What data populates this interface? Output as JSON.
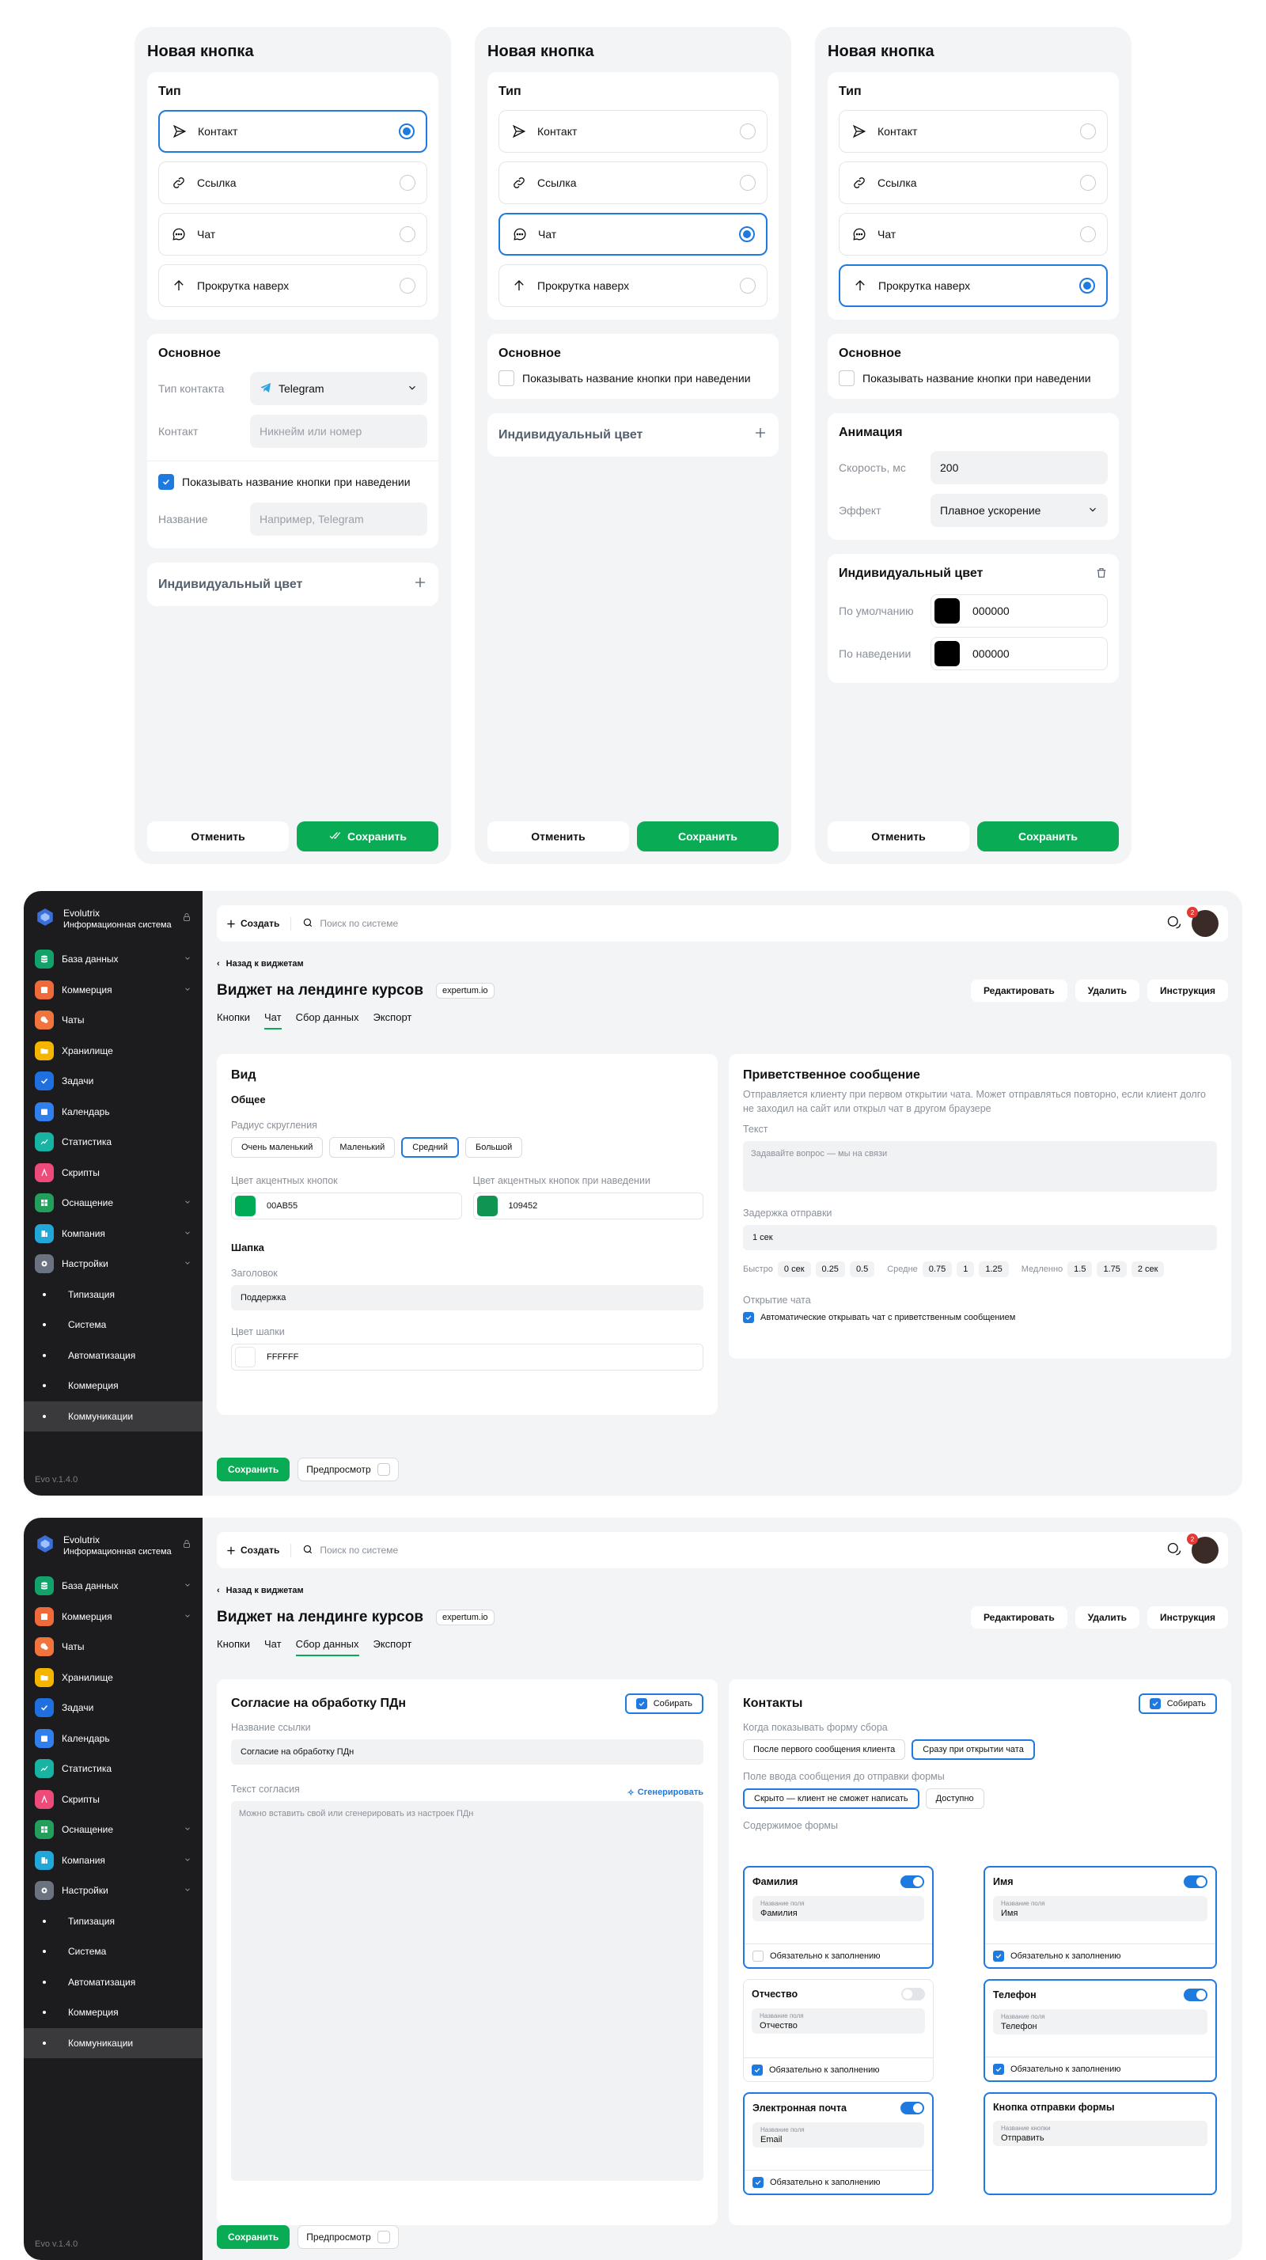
{
  "modals": [
    {
      "title": "Новая кнопка",
      "type_heading": "Тип",
      "options": [
        "Контакт",
        "Ссылка",
        "Чат",
        "Прокрутка наверх"
      ],
      "selected": 0,
      "basic": {
        "heading": "Основное",
        "contact_type_label": "Тип контакта",
        "contact_type_value": "Telegram",
        "contact_label": "Контакт",
        "contact_placeholder": "Никнейм или номер",
        "show_name": "Показывать название кнопки при наведении",
        "name_label": "Название",
        "name_placeholder": "Например, Telegram"
      },
      "custom_color": "Индивидуальный цвет",
      "cancel": "Отменить",
      "save": "Сохранить"
    },
    {
      "title": "Новая кнопка",
      "type_heading": "Тип",
      "options": [
        "Контакт",
        "Ссылка",
        "Чат",
        "Прокрутка наверх"
      ],
      "selected": 2,
      "basic": {
        "heading": "Основное",
        "show_name": "Показывать название кнопки при наведении"
      },
      "custom_color": "Индивидуальный цвет",
      "cancel": "Отменить",
      "save": "Сохранить"
    },
    {
      "title": "Новая кнопка",
      "type_heading": "Тип",
      "options": [
        "Контакт",
        "Ссылка",
        "Чат",
        "Прокрутка наверх"
      ],
      "selected": 3,
      "basic": {
        "heading": "Основное",
        "show_name": "Показывать название кнопки при наведении"
      },
      "animation": {
        "heading": "Анимация",
        "speed_label": "Скорость, мс",
        "speed_value": "200",
        "effect_label": "Эффект",
        "effect_value": "Плавное ускорение"
      },
      "custom_color": {
        "heading": "Индивидуальный цвет",
        "default_label": "По умолчанию",
        "default_value": "000000",
        "hover_label": "По наведении",
        "hover_value": "000000"
      },
      "cancel": "Отменить",
      "save": "Сохранить"
    }
  ],
  "app": {
    "brand_name": "Evolutrix",
    "brand_sub": "Информационная система",
    "version": "Evo v.1.4.0",
    "nav": [
      {
        "label": "База данных",
        "color": "#12a36b",
        "chev": true
      },
      {
        "label": "Коммерция",
        "color": "#ef6a3a",
        "chev": true
      },
      {
        "label": "Чаты",
        "color": "#f0743c",
        "chev": false
      },
      {
        "label": "Хранилище",
        "color": "#f4b400",
        "chev": false
      },
      {
        "label": "Задачи",
        "color": "#1f6fe0",
        "chev": false
      },
      {
        "label": "Календарь",
        "color": "#2f80ed",
        "chev": false
      },
      {
        "label": "Статистика",
        "color": "#17b3a3",
        "chev": false
      },
      {
        "label": "Скрипты",
        "color": "#ee4b7a",
        "chev": false
      },
      {
        "label": "Оснащение",
        "color": "#22a05b",
        "chev": true
      },
      {
        "label": "Компания",
        "color": "#22a8d8",
        "chev": true
      },
      {
        "label": "Настройки",
        "color": "#6b7280",
        "chev": true
      }
    ],
    "sub": [
      "Типизация",
      "Система",
      "Автоматизация",
      "Коммерция",
      "Коммуникации"
    ],
    "create": "Создать",
    "search_placeholder": "Поиск по системе",
    "chat_badge": "2",
    "back": "Назад к виджетам",
    "title": "Виджет на лендинге курсов",
    "domain": "expertum.io",
    "actions": [
      "Редактировать",
      "Удалить",
      "Инструкция"
    ],
    "tabs": [
      "Кнопки",
      "Чат",
      "Сбор данных",
      "Экспорт"
    ],
    "save": "Сохранить",
    "preview": "Предпросмотр"
  },
  "chat_tab": {
    "view": {
      "heading": "Вид",
      "general": "Общее",
      "radius_label": "Радиус скругления",
      "radius_options": [
        "Очень маленький",
        "Маленький",
        "Средний",
        "Большой"
      ],
      "radius_selected": 2,
      "accent_label": "Цвет акцентных кнопок",
      "accent_value": "00AB55",
      "accent_hover_label": "Цвет акцентных кнопок при наведении",
      "accent_hover_value": "109452",
      "header_heading": "Шапка",
      "header_title_label": "Заголовок",
      "header_title_value": "Поддержка",
      "header_color_label": "Цвет шапки",
      "header_color_value": "FFFFFF"
    },
    "welcome": {
      "heading": "Приветственное сообщение",
      "desc": "Отправляется клиенту при первом открытии чата. Может отправляться повторно, если клиент долго не заходил на сайт или открыл чат в другом браузере",
      "text_label": "Текст",
      "text_placeholder": "Задавайте вопрос — мы на связи",
      "delay_label": "Задержка отправки",
      "delay_value": "1 сек",
      "fast": "Быстро",
      "fast_vals": [
        "0 сек",
        "0.25",
        "0.5"
      ],
      "mid": "Средне",
      "mid_vals": [
        "0.75",
        "1",
        "1.25"
      ],
      "slow": "Медленно",
      "slow_vals": [
        "1.5",
        "1.75",
        "2 сек"
      ],
      "open_label": "Открытие чата",
      "open_check": "Автоматические открывать чат с приветственным сообщением"
    }
  },
  "collect_tab": {
    "consent": {
      "heading": "Согласие на обработку ПДн",
      "collect": "Собирать",
      "link_label": "Название ссылки",
      "link_value": "Согласие на обработку ПДн",
      "text_label": "Текст согласия",
      "generate": "Сгенерировать",
      "text_placeholder": "Можно вставить свой или сгенерировать из настроек ПДн"
    },
    "contacts": {
      "heading": "Контакты",
      "collect": "Собирать",
      "when_label": "Когда показывать форму сбора",
      "when_options": [
        "После первого сообщения клиента",
        "Сразу при открытии чата"
      ],
      "input_label": "Поле ввода сообщения до отправки формы",
      "input_options": [
        "Скрыто — клиент не сможет написать",
        "Доступно"
      ],
      "content_label": "Содержимое формы",
      "field_name_label": "Название поля",
      "required": "Обязательно к заполнению",
      "fields": [
        {
          "title": "Фамилия",
          "value": "Фамилия",
          "on": true,
          "req": false
        },
        {
          "title": "Имя",
          "value": "Имя",
          "on": true,
          "req": true
        },
        {
          "title": "Отчество",
          "value": "Отчество",
          "on": false,
          "req": true
        },
        {
          "title": "Телефон",
          "value": "Телефон",
          "on": true,
          "req": true
        },
        {
          "title": "Электронная почта",
          "value": "Email",
          "on": true,
          "req": true
        }
      ],
      "submit": {
        "title": "Кнопка отправки формы",
        "label": "Название кнопки",
        "value": "Отправить"
      }
    }
  },
  "colors": {
    "accent": "#0aab55",
    "blue": "#1f7ae0",
    "sidebar": "#1c1c1e"
  }
}
